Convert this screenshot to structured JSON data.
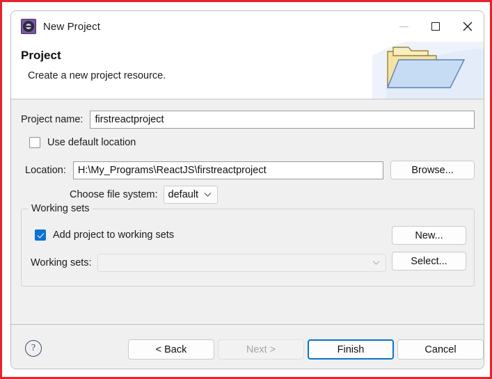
{
  "window": {
    "title": "New Project",
    "icon": "eclipse-gear-icon",
    "controls": {
      "minimize": "minimize-icon",
      "maximize": "maximize-icon",
      "close": "close-icon"
    }
  },
  "banner": {
    "title": "Project",
    "subtitle": "Create a new project resource.",
    "art": "open-folder-icon"
  },
  "form": {
    "project_name_label": "Project name:",
    "project_name_value": "firstreactproject",
    "project_name_placeholder": "",
    "use_default_location_label": "Use default location",
    "use_default_location_checked": false,
    "location_label": "Location:",
    "location_value": "H:\\My_Programs\\ReactJS\\firstreactproject",
    "location_placeholder": "",
    "browse_label": "Browse...",
    "file_system_label": "Choose file system:",
    "file_system_value": "default",
    "file_system_options": [
      "default"
    ]
  },
  "working_sets": {
    "group_title": "Working sets",
    "add_checkbox_label": "Add project to working sets",
    "add_checkbox_checked": true,
    "new_label": "New...",
    "sets_label": "Working sets:",
    "sets_value": "",
    "select_label": "Select..."
  },
  "footer": {
    "help": "?",
    "back_label": "< Back",
    "next_label": "Next >",
    "next_disabled": true,
    "finish_label": "Finish",
    "finish_default": true,
    "cancel_label": "Cancel"
  },
  "colors": {
    "accent": "#0a72d2",
    "capture_border": "#e8222a",
    "dialog_bg": "#f0f0f0",
    "header_bg": "#ffffff"
  }
}
